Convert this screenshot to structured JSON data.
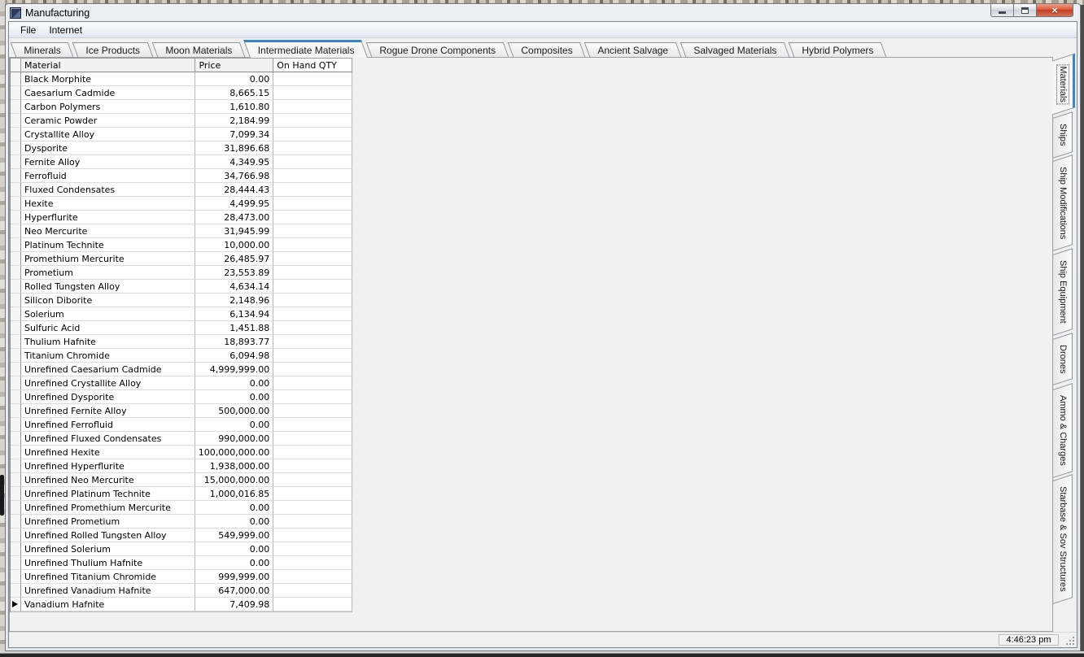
{
  "window": {
    "title": "Manufacturing",
    "controls": {
      "minimize": "minimize",
      "maximize": "maximize",
      "close": "close",
      "close_glyph": "×"
    }
  },
  "menu": {
    "items": [
      {
        "label": "File"
      },
      {
        "label": "Internet"
      }
    ]
  },
  "top_tabs": {
    "items": [
      {
        "label": "Minerals",
        "selected": false
      },
      {
        "label": "Ice Products",
        "selected": false
      },
      {
        "label": "Moon Materials",
        "selected": false
      },
      {
        "label": "Intermediate Materials",
        "selected": true
      },
      {
        "label": "Rogue Drone Components",
        "selected": false
      },
      {
        "label": "Composites",
        "selected": false
      },
      {
        "label": "Ancient Salvage",
        "selected": false
      },
      {
        "label": "Salvaged Materials",
        "selected": false
      },
      {
        "label": "Hybrid Polymers",
        "selected": false
      }
    ]
  },
  "right_tabs": {
    "items": [
      {
        "label": "Materials",
        "selected": true
      },
      {
        "label": "Ships",
        "selected": false
      },
      {
        "label": "Ship Modifications",
        "selected": false
      },
      {
        "label": "Ship Equipment",
        "selected": false
      },
      {
        "label": "Drones",
        "selected": false
      },
      {
        "label": "Ammo & Charges",
        "selected": false
      },
      {
        "label": "Starbase & Sov Structures",
        "selected": false
      }
    ]
  },
  "table": {
    "columns": [
      "Material",
      "Price",
      "On Hand QTY"
    ],
    "rows": [
      {
        "material": "Black Morphite",
        "price": "0.00",
        "qty": "",
        "current": false
      },
      {
        "material": "Caesarium Cadmide",
        "price": "8,665.15",
        "qty": "",
        "current": false
      },
      {
        "material": "Carbon Polymers",
        "price": "1,610.80",
        "qty": "",
        "current": false
      },
      {
        "material": "Ceramic Powder",
        "price": "2,184.99",
        "qty": "",
        "current": false
      },
      {
        "material": "Crystallite Alloy",
        "price": "7,099.34",
        "qty": "",
        "current": false
      },
      {
        "material": "Dysporite",
        "price": "31,896.68",
        "qty": "",
        "current": false
      },
      {
        "material": "Fernite Alloy",
        "price": "4,349.95",
        "qty": "",
        "current": false
      },
      {
        "material": "Ferrofluid",
        "price": "34,766.98",
        "qty": "",
        "current": false
      },
      {
        "material": "Fluxed Condensates",
        "price": "28,444.43",
        "qty": "",
        "current": false
      },
      {
        "material": "Hexite",
        "price": "4,499.95",
        "qty": "",
        "current": false
      },
      {
        "material": "Hyperflurite",
        "price": "28,473.00",
        "qty": "",
        "current": false
      },
      {
        "material": "Neo Mercurite",
        "price": "31,945.99",
        "qty": "",
        "current": false
      },
      {
        "material": "Platinum Technite",
        "price": "10,000.00",
        "qty": "",
        "current": false
      },
      {
        "material": "Promethium Mercurite",
        "price": "26,485.97",
        "qty": "",
        "current": false
      },
      {
        "material": "Prometium",
        "price": "23,553.89",
        "qty": "",
        "current": false
      },
      {
        "material": "Rolled Tungsten Alloy",
        "price": "4,634.14",
        "qty": "",
        "current": false
      },
      {
        "material": "Silicon Diborite",
        "price": "2,148.96",
        "qty": "",
        "current": false
      },
      {
        "material": "Solerium",
        "price": "6,134.94",
        "qty": "",
        "current": false
      },
      {
        "material": "Sulfuric Acid",
        "price": "1,451.88",
        "qty": "",
        "current": false
      },
      {
        "material": "Thulium Hafnite",
        "price": "18,893.77",
        "qty": "",
        "current": false
      },
      {
        "material": "Titanium Chromide",
        "price": "6,094.98",
        "qty": "",
        "current": false
      },
      {
        "material": "Unrefined Caesarium Cadmide",
        "price": "4,999,999.00",
        "qty": "",
        "current": false
      },
      {
        "material": "Unrefined Crystallite Alloy",
        "price": "0.00",
        "qty": "",
        "current": false
      },
      {
        "material": "Unrefined Dysporite",
        "price": "0.00",
        "qty": "",
        "current": false
      },
      {
        "material": "Unrefined Fernite Alloy",
        "price": "500,000.00",
        "qty": "",
        "current": false
      },
      {
        "material": "Unrefined Ferrofluid",
        "price": "0.00",
        "qty": "",
        "current": false
      },
      {
        "material": "Unrefined Fluxed Condensates",
        "price": "990,000.00",
        "qty": "",
        "current": false
      },
      {
        "material": "Unrefined Hexite",
        "price": "100,000,000.00",
        "qty": "",
        "current": false
      },
      {
        "material": "Unrefined Hyperflurite",
        "price": "1,938,000.00",
        "qty": "",
        "current": false
      },
      {
        "material": "Unrefined Neo Mercurite",
        "price": "15,000,000.00",
        "qty": "",
        "current": false
      },
      {
        "material": "Unrefined Platinum Technite",
        "price": "1,000,016.85",
        "qty": "",
        "current": false
      },
      {
        "material": "Unrefined Promethium Mercurite",
        "price": "0.00",
        "qty": "",
        "current": false
      },
      {
        "material": "Unrefined Prometium",
        "price": "0.00",
        "qty": "",
        "current": false
      },
      {
        "material": "Unrefined Rolled Tungsten Alloy",
        "price": "549,999.00",
        "qty": "",
        "current": false
      },
      {
        "material": "Unrefined Solerium",
        "price": "0.00",
        "qty": "",
        "current": false
      },
      {
        "material": "Unrefined Thulium Hafnite",
        "price": "0.00",
        "qty": "",
        "current": false
      },
      {
        "material": "Unrefined Titanium Chromide",
        "price": "999,999.00",
        "qty": "",
        "current": false
      },
      {
        "material": "Unrefined Vanadium Hafnite",
        "price": "647,000.00",
        "qty": "",
        "current": false
      },
      {
        "material": "Vanadium Hafnite",
        "price": "7,409.98",
        "qty": "",
        "current": true
      }
    ]
  },
  "status": {
    "time": "4:46:23 pm"
  },
  "icons": {
    "window_icon": "app-window-icon",
    "minimize_icon": "minimize-bar",
    "maximize_icon": "maximize-square",
    "close_icon": "close-x",
    "current_row_icon": "right-triangle-marker",
    "size_grip_icon": "resize-grip-dots"
  },
  "colors": {
    "accent": "#3a87c8",
    "close_button": "#c23a1e",
    "client_background": "#f1f1f1"
  }
}
